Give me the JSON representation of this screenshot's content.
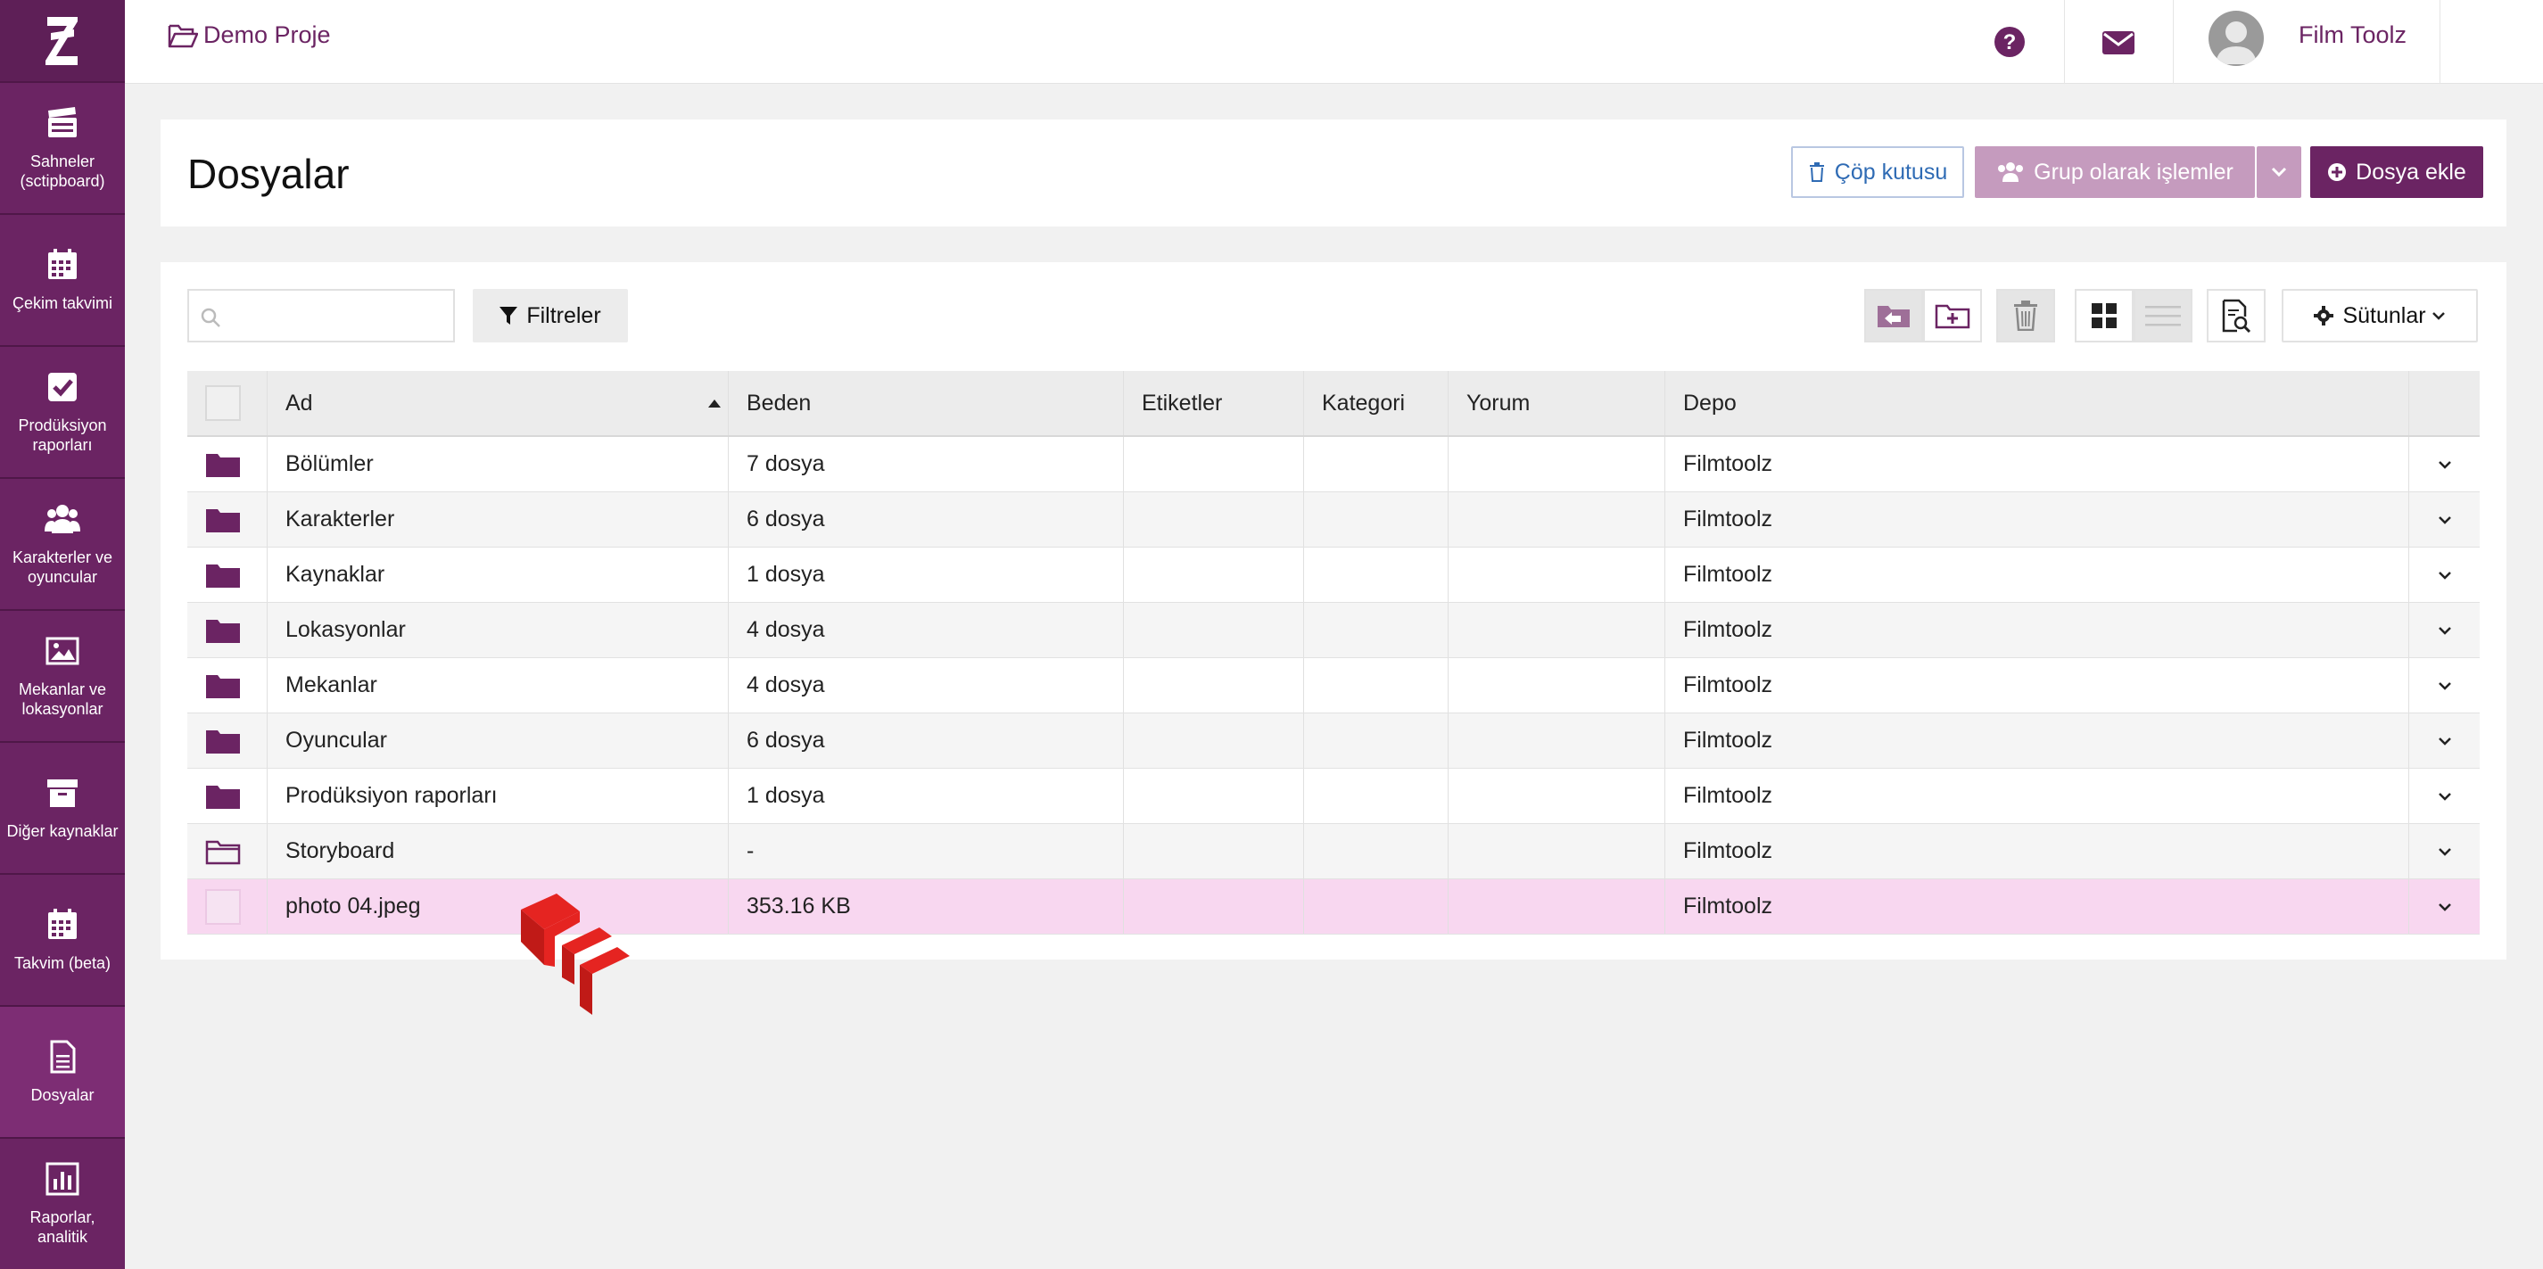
{
  "sidebar": {
    "items": [
      {
        "label": "Sahneler (sctipboard)",
        "icon": "clapperboard-icon"
      },
      {
        "label": "Çekim takvimi",
        "icon": "calendar-icon"
      },
      {
        "label": "Prodüksiyon raporları",
        "icon": "checkbox-icon"
      },
      {
        "label": "Karakterler ve oyuncular",
        "icon": "users-icon"
      },
      {
        "label": "Mekanlar ve lokasyonlar",
        "icon": "image-icon"
      },
      {
        "label": "Diğer kaynaklar",
        "icon": "archive-icon"
      },
      {
        "label": "Takvim (beta)",
        "icon": "calendar-icon"
      },
      {
        "label": "Dosyalar",
        "icon": "document-icon"
      },
      {
        "label": "Raporlar, analitik",
        "icon": "bar-chart-icon"
      }
    ],
    "active_index": 7
  },
  "topbar": {
    "project_name": "Demo Proje",
    "user_name": "Film Toolz",
    "language": "TR"
  },
  "header": {
    "title": "Dosyalar",
    "trash_label": "Çöp kutusu",
    "group_label": "Grup olarak işlemler",
    "add_file_label": "Dosya ekle"
  },
  "toolbar": {
    "search_placeholder": "",
    "filter_label": "Filtreler",
    "columns_label": "Sütunlar"
  },
  "table": {
    "columns": [
      "Ad",
      "Beden",
      "Etiketler",
      "Kategori",
      "Yorum",
      "Depo"
    ],
    "rows": [
      {
        "type": "folder",
        "name": "Bölümler",
        "size": "7 dosya",
        "tags": "",
        "category": "",
        "comment": "",
        "storage": "Filmtoolz"
      },
      {
        "type": "folder",
        "name": "Karakterler",
        "size": "6 dosya",
        "tags": "",
        "category": "",
        "comment": "",
        "storage": "Filmtoolz"
      },
      {
        "type": "folder",
        "name": "Kaynaklar",
        "size": "1 dosya",
        "tags": "",
        "category": "",
        "comment": "",
        "storage": "Filmtoolz"
      },
      {
        "type": "folder",
        "name": "Lokasyonlar",
        "size": "4 dosya",
        "tags": "",
        "category": "",
        "comment": "",
        "storage": "Filmtoolz"
      },
      {
        "type": "folder",
        "name": "Mekanlar",
        "size": "4 dosya",
        "tags": "",
        "category": "",
        "comment": "",
        "storage": "Filmtoolz"
      },
      {
        "type": "folder",
        "name": "Oyuncular",
        "size": "6 dosya",
        "tags": "",
        "category": "",
        "comment": "",
        "storage": "Filmtoolz"
      },
      {
        "type": "folder",
        "name": "Prodüksiyon raporları",
        "size": "1 dosya",
        "tags": "",
        "category": "",
        "comment": "",
        "storage": "Filmtoolz"
      },
      {
        "type": "folder-empty",
        "name": "Storyboard",
        "size": "-",
        "tags": "",
        "category": "",
        "comment": "",
        "storage": "Filmtoolz"
      },
      {
        "type": "file",
        "name": "photo 04.jpeg",
        "size": "353.16 KB",
        "tags": "",
        "category": "",
        "comment": "",
        "storage": "Filmtoolz"
      }
    ]
  },
  "colors": {
    "brand": "#6b2463",
    "brand_light": "#c59bbe",
    "selected_row": "#f8d7f0",
    "link_blue": "#2f6bb4"
  }
}
